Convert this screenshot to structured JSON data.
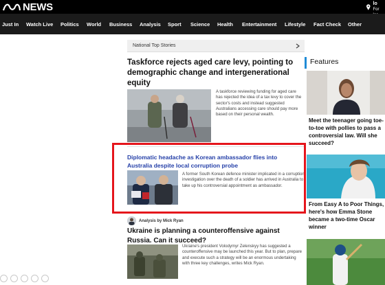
{
  "header": {
    "logo_text": "NEWS",
    "location_line1": "Set lo",
    "location_line2": "For loc"
  },
  "nav": {
    "items": [
      "Just In",
      "Watch Live",
      "Politics",
      "World",
      "Business",
      "Analysis",
      "Sport",
      "Science",
      "Health",
      "Entertainment",
      "Lifestyle",
      "Fact Check",
      "Other"
    ]
  },
  "section": {
    "title": "National Top Stories"
  },
  "stories": [
    {
      "title": "Taskforce rejects aged care levy, pointing to demographic change and intergenerational equity",
      "description": "A taskforce reviewing funding for aged care has rejected the idea of a tax levy to cover the sector's costs and instead suggested Australians accessing care should pay more based on their personal wealth."
    },
    {
      "title": "Diplomatic headache as Korean ambassador flies into Australia despite local corruption probe",
      "description": "A former South Korean defence minister implicated in a corruption investigation over the death of a soldier has arrived in Australia to take up his controversial appointment as ambassador."
    },
    {
      "analysis_label": "Analysis by Mick Ryan",
      "title": "Ukraine is planning a counteroffensive against Russia. Can it succeed?",
      "description": "Ukraine's president Volodymyr Zelenskyy has suggested a counteroffensive may be launched this year. But to plan, prepare and execute such a strategy will be an enormous undertaking with three key challenges, writes Mick Ryan."
    }
  ],
  "features": {
    "title": "Features",
    "items": [
      {
        "title": "Meet the teenager going toe-to-toe with pollies to pass a controversial law. Will she succeed?"
      },
      {
        "title": "From Easy A to Poor Things, here's how Emma Stone became a two-time Oscar winner"
      },
      {
        "title": ""
      }
    ]
  },
  "colors": {
    "highlight": "#e5141b",
    "features_accent": "#1f8bd6",
    "link_blue": "#2540a8"
  }
}
